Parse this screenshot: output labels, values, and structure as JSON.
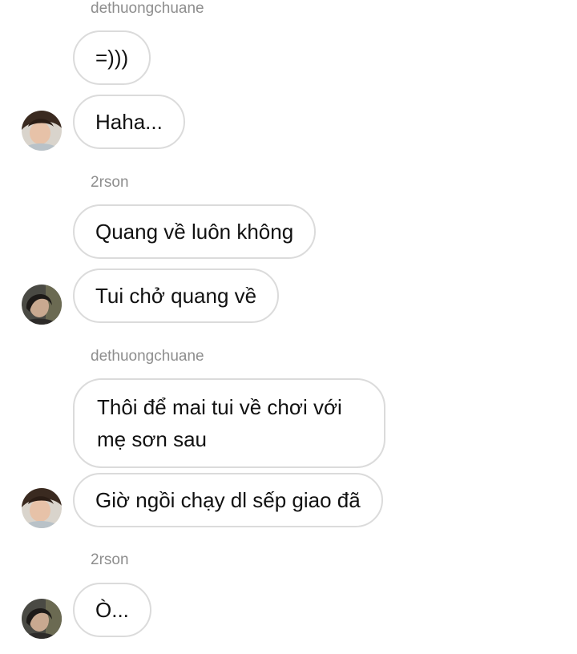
{
  "groups": [
    {
      "sender": "dethuongchuane",
      "messages": [
        "=)))",
        "Haha..."
      ]
    },
    {
      "sender": "2rson",
      "messages": [
        "Quang về luôn không",
        "Tui chở quang về"
      ]
    },
    {
      "sender": "dethuongchuane",
      "messages": [
        "Thôi để mai tui về chơi với mẹ sơn sau",
        "Giờ ngồi chạy dl sếp giao đã"
      ]
    },
    {
      "sender": "2rson",
      "messages": [
        "Ò..."
      ]
    }
  ],
  "avatars": {
    "dethuongchuane": "avatar-light-photo",
    "2rson": "avatar-dark-photo"
  },
  "colors": {
    "sender_text": "#8e8e8e",
    "bubble_border": "#dbdbdb",
    "message_text": "#111111"
  }
}
